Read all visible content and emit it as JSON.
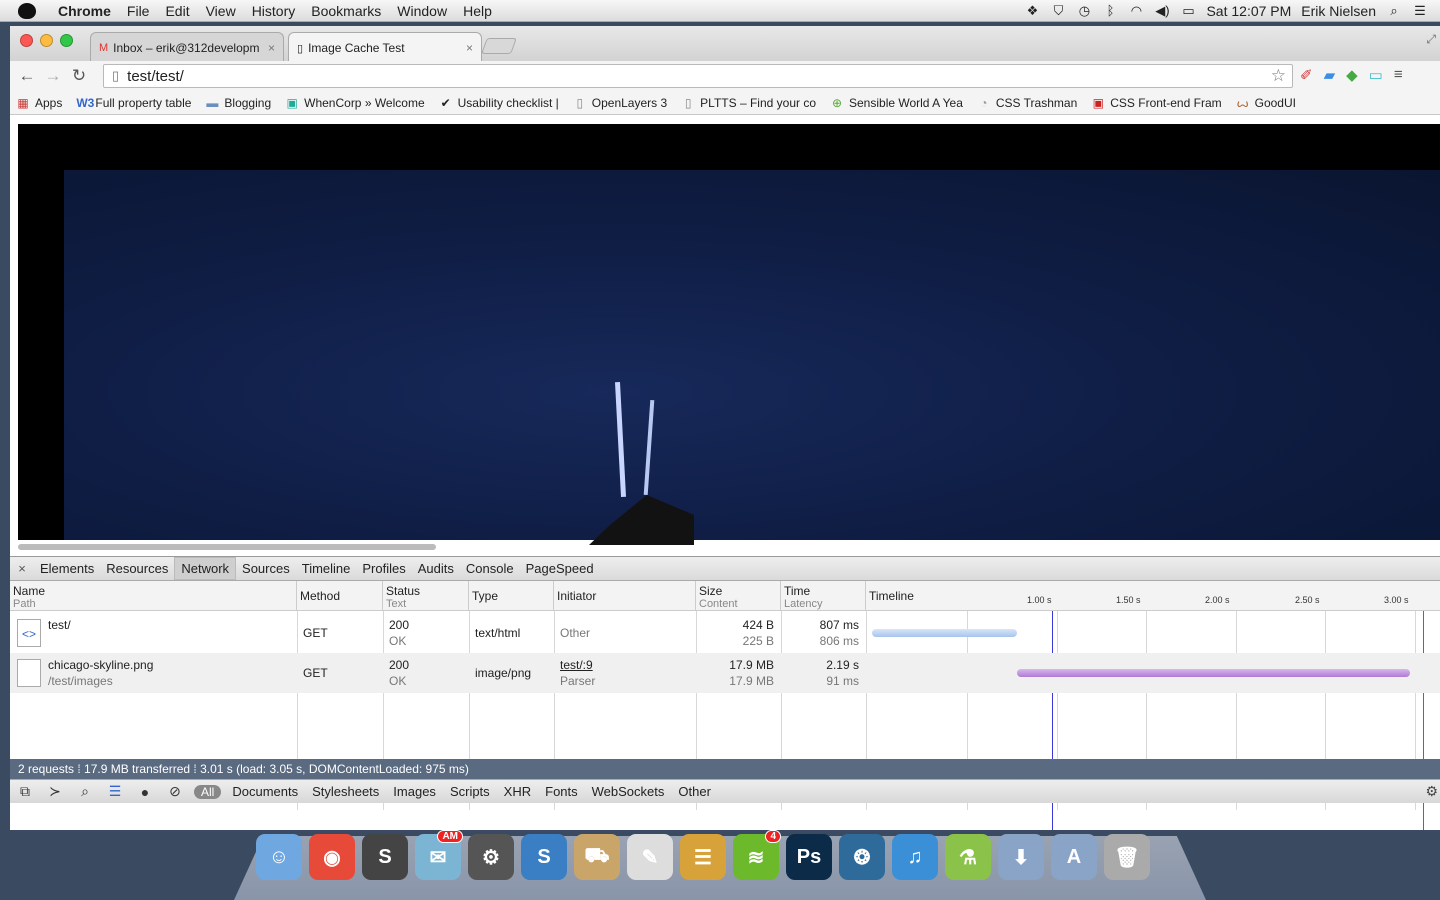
{
  "menubar": {
    "app": "Chrome",
    "items": [
      "File",
      "Edit",
      "View",
      "History",
      "Bookmarks",
      "Window",
      "Help"
    ],
    "clock": "Sat 12:07 PM",
    "user": "Erik Nielsen"
  },
  "tabs": [
    {
      "title": "Inbox – erik@312developm",
      "icon": "gmail-icon"
    },
    {
      "title": "Image Cache Test",
      "icon": "page-icon"
    }
  ],
  "omnibox": {
    "url": "test/test/"
  },
  "bookmarks": [
    {
      "label": "Apps",
      "icon": "apps-icon"
    },
    {
      "label": "Full property table",
      "icon": "w3-icon"
    },
    {
      "label": "Blogging",
      "icon": "folder-icon"
    },
    {
      "label": "WhenCorp » Welcome",
      "icon": "calendar-icon"
    },
    {
      "label": "Usability checklist | ",
      "icon": "check-icon"
    },
    {
      "label": "OpenLayers 3",
      "icon": "page-icon"
    },
    {
      "label": "PLTTS – Find your co",
      "icon": "page-icon"
    },
    {
      "label": "Sensible World A Yea",
      "icon": "globe-icon"
    },
    {
      "label": "CSS Trashman",
      "icon": "trash-icon"
    },
    {
      "label": "CSS Front-end Fram",
      "icon": "css-icon"
    },
    {
      "label": "GoodUI",
      "icon": "goodui-icon"
    }
  ],
  "devtools": {
    "tabs": [
      "Elements",
      "Resources",
      "Network",
      "Sources",
      "Timeline",
      "Profiles",
      "Audits",
      "Console",
      "PageSpeed"
    ],
    "active_tab": "Network",
    "columns": {
      "name": "Name",
      "name_sub": "Path",
      "method": "Method",
      "status": "Status",
      "status_sub": "Text",
      "type": "Type",
      "initiator": "Initiator",
      "size": "Size",
      "size_sub": "Content",
      "time": "Time",
      "time_sub": "Latency",
      "timeline": "Timeline"
    },
    "ticks": [
      "1.00 s",
      "1.50 s",
      "2.00 s",
      "2.50 s",
      "3.00 s"
    ],
    "requests": [
      {
        "name": "test/",
        "path": "",
        "method": "GET",
        "status": "200",
        "status_text": "OK",
        "type": "text/html",
        "initiator": "Other",
        "initiator_sub": "",
        "size": "424 B",
        "content": "225 B",
        "time": "807 ms",
        "latency": "806 ms",
        "start_s": 0,
        "end_s": 0.807
      },
      {
        "name": "chicago-skyline.png",
        "path": "/test/images",
        "method": "GET",
        "status": "200",
        "status_text": "OK",
        "type": "image/png",
        "initiator": "test/:9",
        "initiator_sub": "Parser",
        "size": "17.9 MB",
        "content": "17.9 MB",
        "time": "2.19 s",
        "latency": "91 ms",
        "start_s": 0.807,
        "end_s": 3.0
      }
    ],
    "summary": "2 requests  ⁞  17.9 MB transferred  ⁞  3.01 s (load: 3.05 s, DOMContentLoaded: 975 ms)",
    "filters": [
      "All",
      "Documents",
      "Stylesheets",
      "Images",
      "Scripts",
      "XHR",
      "Fonts",
      "WebSockets",
      "Other"
    ]
  },
  "dock": [
    {
      "name": "finder-icon",
      "color": "#6fa7e0",
      "glyph": "☺"
    },
    {
      "name": "chrome-icon",
      "color": "#e84a3a",
      "glyph": "◉"
    },
    {
      "name": "sublime-icon",
      "color": "#444",
      "glyph": "S"
    },
    {
      "name": "evernote-icon",
      "color": "#7cb4d4",
      "glyph": "✉",
      "badge": "AM"
    },
    {
      "name": "preferences-icon",
      "color": "#555",
      "glyph": "⚙"
    },
    {
      "name": "s-app-icon",
      "color": "#3a7ec4",
      "glyph": "S"
    },
    {
      "name": "transmit-icon",
      "color": "#c9a56a",
      "glyph": "⛟"
    },
    {
      "name": "textedit-icon",
      "color": "#ddd",
      "glyph": "✎"
    },
    {
      "name": "sequel-icon",
      "color": "#d8a23a",
      "glyph": "☰"
    },
    {
      "name": "spotify-icon",
      "color": "#6cba2c",
      "glyph": "≋",
      "badge": "4"
    },
    {
      "name": "photoshop-icon",
      "color": "#0c2b49",
      "glyph": "Ps"
    },
    {
      "name": "sourcetree-icon",
      "color": "#2f6b9a",
      "glyph": "❂"
    },
    {
      "name": "itunes-icon",
      "color": "#3b8fd6",
      "glyph": "♫"
    },
    {
      "name": "flask-icon",
      "color": "#8bc34a",
      "glyph": "⚗"
    },
    {
      "name": "downloads-folder-icon",
      "color": "#8aa4c8",
      "glyph": "⬇"
    },
    {
      "name": "applications-folder-icon",
      "color": "#8aa4c8",
      "glyph": "A"
    },
    {
      "name": "trash-icon",
      "color": "#aaa",
      "glyph": "🗑"
    }
  ]
}
